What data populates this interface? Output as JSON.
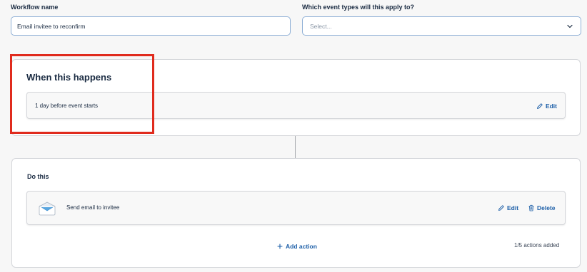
{
  "form": {
    "workflow_name_label": "Workflow name",
    "workflow_name_value": "Email invitee to reconfirm",
    "event_types_label": "Which event types will this apply to?",
    "event_types_placeholder": "Select..."
  },
  "trigger": {
    "title": "When this happens",
    "condition": "1 day before event starts",
    "edit_label": "Edit"
  },
  "actions": {
    "title": "Do this",
    "items": [
      {
        "label": "Send email to invitee",
        "edit_label": "Edit",
        "delete_label": "Delete"
      }
    ],
    "add_action_label": "Add action",
    "count_text": "1/5 actions added"
  },
  "colors": {
    "accent": "#1d5fa8",
    "highlight": "#e02b1d"
  },
  "icons": [
    "chevron-down-icon",
    "pencil-icon",
    "trash-icon",
    "envelope-icon",
    "plus-icon"
  ]
}
